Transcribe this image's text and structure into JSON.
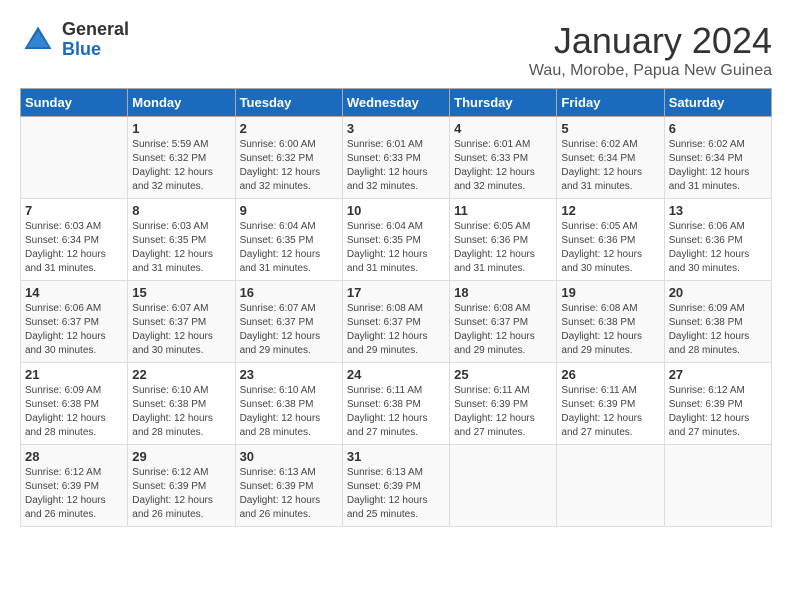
{
  "logo": {
    "general": "General",
    "blue": "Blue"
  },
  "title": "January 2024",
  "location": "Wau, Morobe, Papua New Guinea",
  "days_of_week": [
    "Sunday",
    "Monday",
    "Tuesday",
    "Wednesday",
    "Thursday",
    "Friday",
    "Saturday"
  ],
  "weeks": [
    [
      {
        "day": "",
        "info": ""
      },
      {
        "day": "1",
        "info": "Sunrise: 5:59 AM\nSunset: 6:32 PM\nDaylight: 12 hours\nand 32 minutes."
      },
      {
        "day": "2",
        "info": "Sunrise: 6:00 AM\nSunset: 6:32 PM\nDaylight: 12 hours\nand 32 minutes."
      },
      {
        "day": "3",
        "info": "Sunrise: 6:01 AM\nSunset: 6:33 PM\nDaylight: 12 hours\nand 32 minutes."
      },
      {
        "day": "4",
        "info": "Sunrise: 6:01 AM\nSunset: 6:33 PM\nDaylight: 12 hours\nand 32 minutes."
      },
      {
        "day": "5",
        "info": "Sunrise: 6:02 AM\nSunset: 6:34 PM\nDaylight: 12 hours\nand 31 minutes."
      },
      {
        "day": "6",
        "info": "Sunrise: 6:02 AM\nSunset: 6:34 PM\nDaylight: 12 hours\nand 31 minutes."
      }
    ],
    [
      {
        "day": "7",
        "info": "Sunrise: 6:03 AM\nSunset: 6:34 PM\nDaylight: 12 hours\nand 31 minutes."
      },
      {
        "day": "8",
        "info": "Sunrise: 6:03 AM\nSunset: 6:35 PM\nDaylight: 12 hours\nand 31 minutes."
      },
      {
        "day": "9",
        "info": "Sunrise: 6:04 AM\nSunset: 6:35 PM\nDaylight: 12 hours\nand 31 minutes."
      },
      {
        "day": "10",
        "info": "Sunrise: 6:04 AM\nSunset: 6:35 PM\nDaylight: 12 hours\nand 31 minutes."
      },
      {
        "day": "11",
        "info": "Sunrise: 6:05 AM\nSunset: 6:36 PM\nDaylight: 12 hours\nand 31 minutes."
      },
      {
        "day": "12",
        "info": "Sunrise: 6:05 AM\nSunset: 6:36 PM\nDaylight: 12 hours\nand 30 minutes."
      },
      {
        "day": "13",
        "info": "Sunrise: 6:06 AM\nSunset: 6:36 PM\nDaylight: 12 hours\nand 30 minutes."
      }
    ],
    [
      {
        "day": "14",
        "info": "Sunrise: 6:06 AM\nSunset: 6:37 PM\nDaylight: 12 hours\nand 30 minutes."
      },
      {
        "day": "15",
        "info": "Sunrise: 6:07 AM\nSunset: 6:37 PM\nDaylight: 12 hours\nand 30 minutes."
      },
      {
        "day": "16",
        "info": "Sunrise: 6:07 AM\nSunset: 6:37 PM\nDaylight: 12 hours\nand 29 minutes."
      },
      {
        "day": "17",
        "info": "Sunrise: 6:08 AM\nSunset: 6:37 PM\nDaylight: 12 hours\nand 29 minutes."
      },
      {
        "day": "18",
        "info": "Sunrise: 6:08 AM\nSunset: 6:37 PM\nDaylight: 12 hours\nand 29 minutes."
      },
      {
        "day": "19",
        "info": "Sunrise: 6:08 AM\nSunset: 6:38 PM\nDaylight: 12 hours\nand 29 minutes."
      },
      {
        "day": "20",
        "info": "Sunrise: 6:09 AM\nSunset: 6:38 PM\nDaylight: 12 hours\nand 28 minutes."
      }
    ],
    [
      {
        "day": "21",
        "info": "Sunrise: 6:09 AM\nSunset: 6:38 PM\nDaylight: 12 hours\nand 28 minutes."
      },
      {
        "day": "22",
        "info": "Sunrise: 6:10 AM\nSunset: 6:38 PM\nDaylight: 12 hours\nand 28 minutes."
      },
      {
        "day": "23",
        "info": "Sunrise: 6:10 AM\nSunset: 6:38 PM\nDaylight: 12 hours\nand 28 minutes."
      },
      {
        "day": "24",
        "info": "Sunrise: 6:11 AM\nSunset: 6:38 PM\nDaylight: 12 hours\nand 27 minutes."
      },
      {
        "day": "25",
        "info": "Sunrise: 6:11 AM\nSunset: 6:39 PM\nDaylight: 12 hours\nand 27 minutes."
      },
      {
        "day": "26",
        "info": "Sunrise: 6:11 AM\nSunset: 6:39 PM\nDaylight: 12 hours\nand 27 minutes."
      },
      {
        "day": "27",
        "info": "Sunrise: 6:12 AM\nSunset: 6:39 PM\nDaylight: 12 hours\nand 27 minutes."
      }
    ],
    [
      {
        "day": "28",
        "info": "Sunrise: 6:12 AM\nSunset: 6:39 PM\nDaylight: 12 hours\nand 26 minutes."
      },
      {
        "day": "29",
        "info": "Sunrise: 6:12 AM\nSunset: 6:39 PM\nDaylight: 12 hours\nand 26 minutes."
      },
      {
        "day": "30",
        "info": "Sunrise: 6:13 AM\nSunset: 6:39 PM\nDaylight: 12 hours\nand 26 minutes."
      },
      {
        "day": "31",
        "info": "Sunrise: 6:13 AM\nSunset: 6:39 PM\nDaylight: 12 hours\nand 25 minutes."
      },
      {
        "day": "",
        "info": ""
      },
      {
        "day": "",
        "info": ""
      },
      {
        "day": "",
        "info": ""
      }
    ]
  ]
}
